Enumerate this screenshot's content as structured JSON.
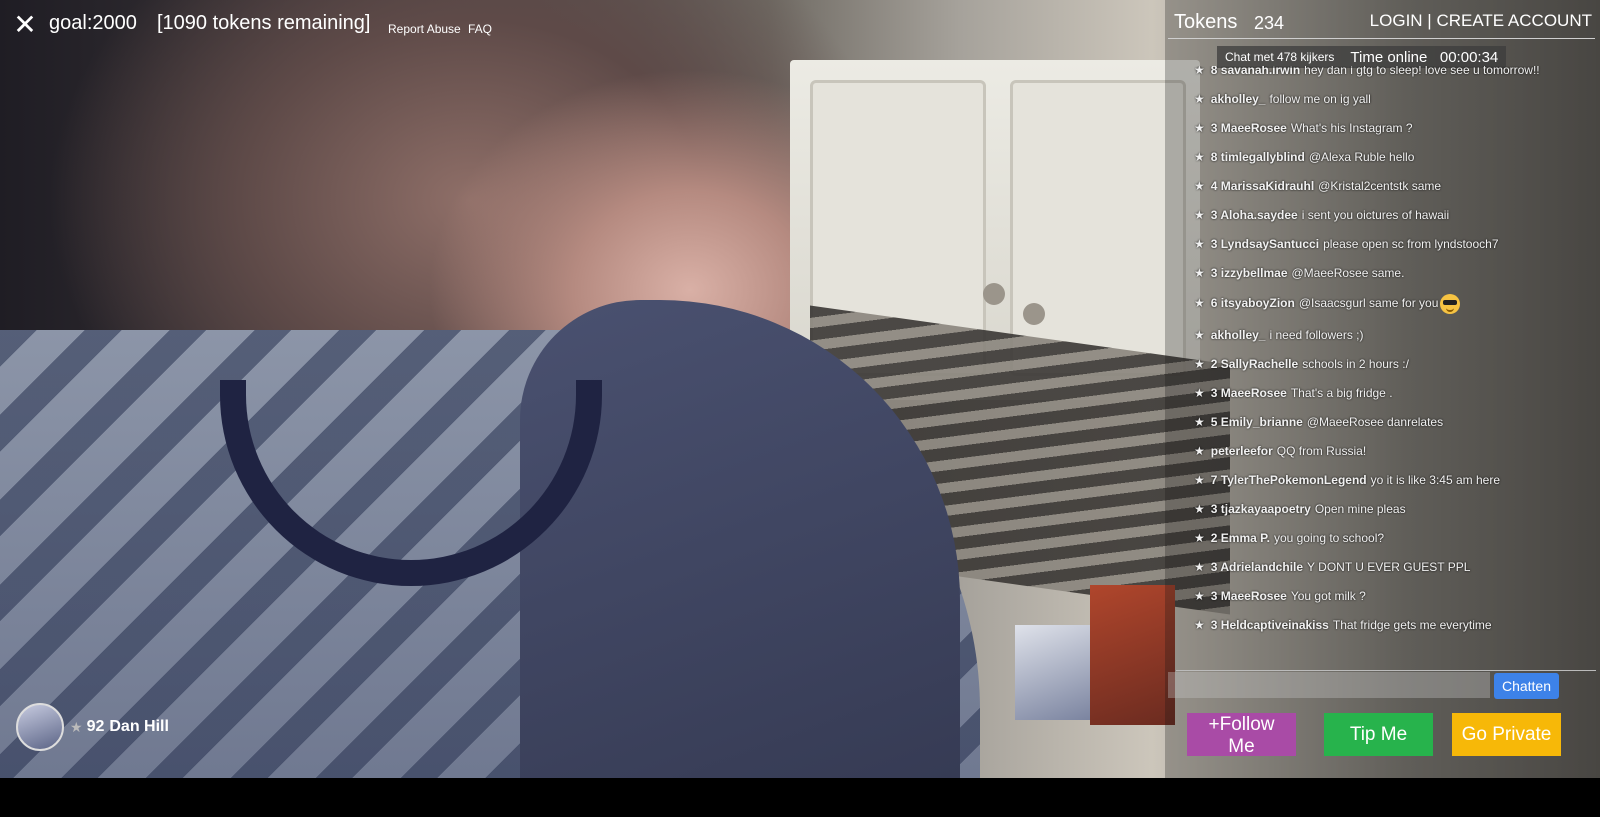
{
  "stream": {
    "goal": "goal:2000",
    "tokens_remaining": "[1090 tokens remaining]",
    "report_abuse": "Report Abuse",
    "faq": "FAQ",
    "close_icon": "close-icon"
  },
  "account": {
    "tokens_label": "Tokens",
    "tokens_value": "234",
    "login": "LOGIN",
    "separator": " | ",
    "create_account": "CREATE ACCOUNT"
  },
  "status": {
    "viewers": "Chat met 478 kijkers",
    "time_online": "Time online   00:00:34"
  },
  "chat": {
    "messages": [
      {
        "level": "8",
        "user": "savanah.irwin",
        "text": "hey dan i gtg to sleep! love see u tomorrow!!"
      },
      {
        "level": "",
        "user": "akholley_",
        "text": "follow me on ig yall"
      },
      {
        "level": "3",
        "user": "MaeeRosee",
        "text": "What's his Instagram ?"
      },
      {
        "level": "8",
        "user": "timlegallyblind",
        "text": "@Alexa Ruble hello"
      },
      {
        "level": "4",
        "user": "MarissaKidrauhl",
        "text": "@Kristal2centstk same"
      },
      {
        "level": "3",
        "user": "Aloha.saydee",
        "text": "i sent you oictures of hawaii"
      },
      {
        "level": "3",
        "user": "LyndsaySantucci",
        "text": "please open sc from lyndstooch7"
      },
      {
        "level": "3",
        "user": "izzybellmae",
        "text": "@MaeeRosee same."
      },
      {
        "level": "6",
        "user": "itsyaboyZion",
        "text": "@Isaacsgurl same for you",
        "emoji": "sunglasses-emoji-icon"
      },
      {
        "level": "",
        "user": "akholley_",
        "text": "i need followers ;)"
      },
      {
        "level": "2",
        "user": "SallyRachelle",
        "text": "schools in 2 hours :/"
      },
      {
        "level": "3",
        "user": "MaeeRosee",
        "text": "That's a big fridge ."
      },
      {
        "level": "5",
        "user": "Emily_brianne",
        "text": "@MaeeRosee danrelates"
      },
      {
        "level": "",
        "user": "peterleefor",
        "text": "QQ from Russia!"
      },
      {
        "level": "7",
        "user": "TylerThePokemonLegend",
        "text": "yo it is like 3:45 am here"
      },
      {
        "level": "3",
        "user": "tjazkayaapoetry",
        "text": "Open mine pleas"
      },
      {
        "level": "2",
        "user": "Emma P.",
        "text": "you going to school?"
      },
      {
        "level": "3",
        "user": "Adrielandchile",
        "text": "Y DONT U EVER GUEST PPL"
      },
      {
        "level": "3",
        "user": "MaeeRosee",
        "text": "You got milk ?"
      },
      {
        "level": "3",
        "user": "Heldcaptiveinakiss",
        "text": "That fridge gets me everytime"
      }
    ],
    "input_value": "",
    "send_label": "Chatten"
  },
  "actions": {
    "follow": "+Follow Me",
    "tip": "Tip Me",
    "private": "Go Private"
  },
  "performer": {
    "level": "92",
    "name": "Dan Hill"
  },
  "colors": {
    "follow": "#a94ba6",
    "tip": "#27b34c",
    "private": "#f7b808",
    "chat_button": "#3d82e8"
  }
}
